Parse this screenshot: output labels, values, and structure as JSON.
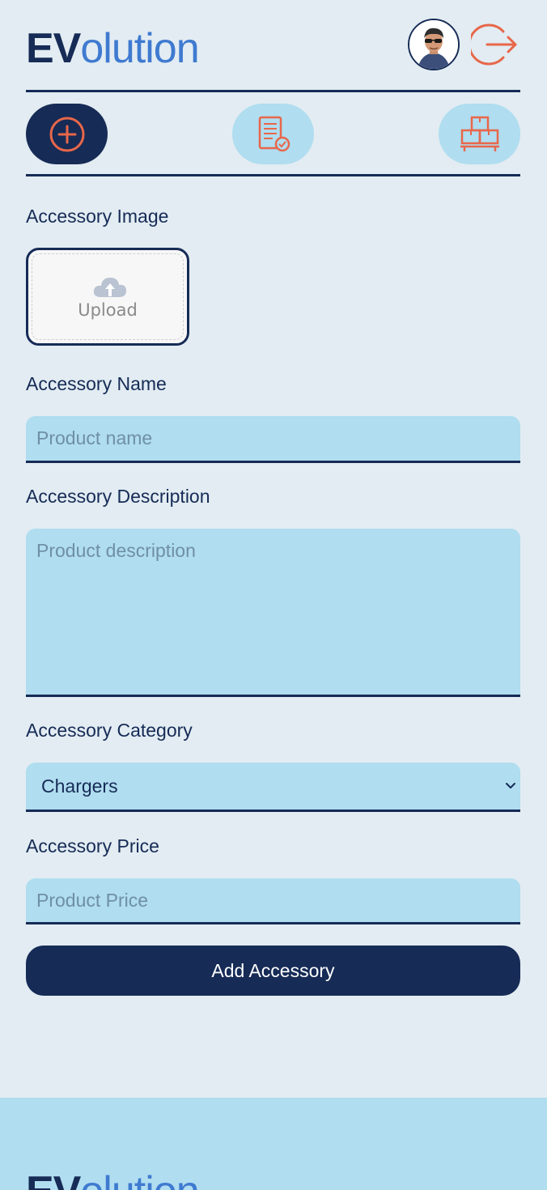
{
  "header": {
    "logo_prefix": "EV",
    "logo_suffix": "olution",
    "avatar_icon": "user-avatar",
    "logout_icon": "logout-icon"
  },
  "nav": {
    "items": [
      {
        "icon": "add-circle-icon",
        "active": true
      },
      {
        "icon": "orders-checklist-icon",
        "active": false
      },
      {
        "icon": "inventory-boxes-icon",
        "active": false
      }
    ]
  },
  "form": {
    "image_label": "Accessory Image",
    "upload_text": "Upload",
    "name_label": "Accessory Name",
    "name_placeholder": "Product name",
    "description_label": "Accessory Description",
    "description_placeholder": "Product description",
    "category_label": "Accessory Category",
    "category_value": "Chargers",
    "price_label": "Accessory Price",
    "price_placeholder": "Product Price",
    "submit_label": "Add Accessory"
  },
  "footer": {
    "logo_prefix": "EV",
    "logo_suffix": "olution"
  },
  "colors": {
    "navy": "#162b56",
    "accent_blue": "#3f7ad0",
    "light_blue": "#b0ddf0",
    "background": "#e2ecf2",
    "icon_orange": "#e8674a"
  }
}
